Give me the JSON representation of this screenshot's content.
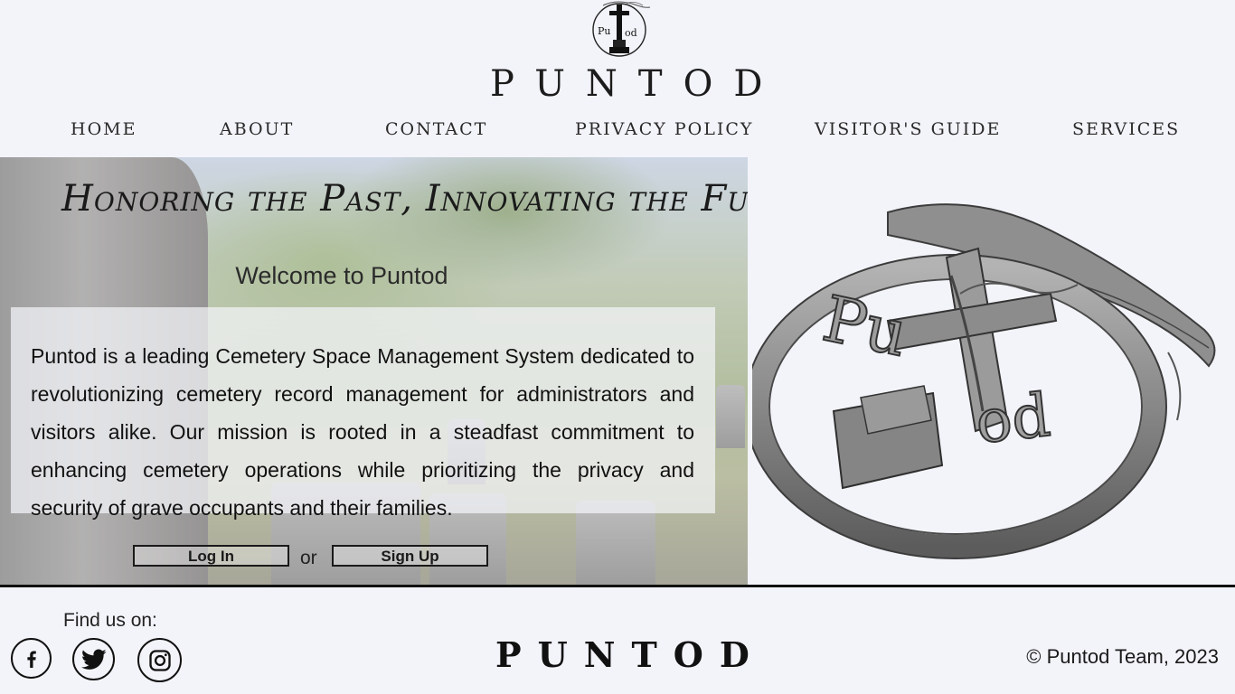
{
  "brand": {
    "name": "PUNTOD",
    "emblem_text": "PUNTOD"
  },
  "nav": [
    {
      "label": "HOME"
    },
    {
      "label": "ABOUT"
    },
    {
      "label": "CONTACT"
    },
    {
      "label": "PRIVACY POLICY"
    },
    {
      "label": "VISITOR'S GUIDE"
    },
    {
      "label": "SERVICES"
    }
  ],
  "hero": {
    "tagline": "Honoring the Past, Innovating the Future",
    "welcome": "Welcome to Puntod",
    "mission": "Puntod is a leading Cemetery Space Management System dedicated to revolutionizing cemetery record management for administrators and visitors alike. Our mission is rooted in a steadfast commitment to enhancing cemetery operations while prioritizing the privacy and security of grave occupants and their families.",
    "login_label": "Log In",
    "or_label": "or",
    "signup_label": "Sign Up"
  },
  "footer": {
    "find_us": "Find us on:",
    "social": [
      "facebook-icon",
      "twitter-icon",
      "instagram-icon"
    ],
    "brand": "PUNTOD",
    "copyright": "© Puntod Team, 2023"
  },
  "colors": {
    "background": "#f3f4fa",
    "text": "#111111",
    "render_gray": "#8a8a8a"
  }
}
